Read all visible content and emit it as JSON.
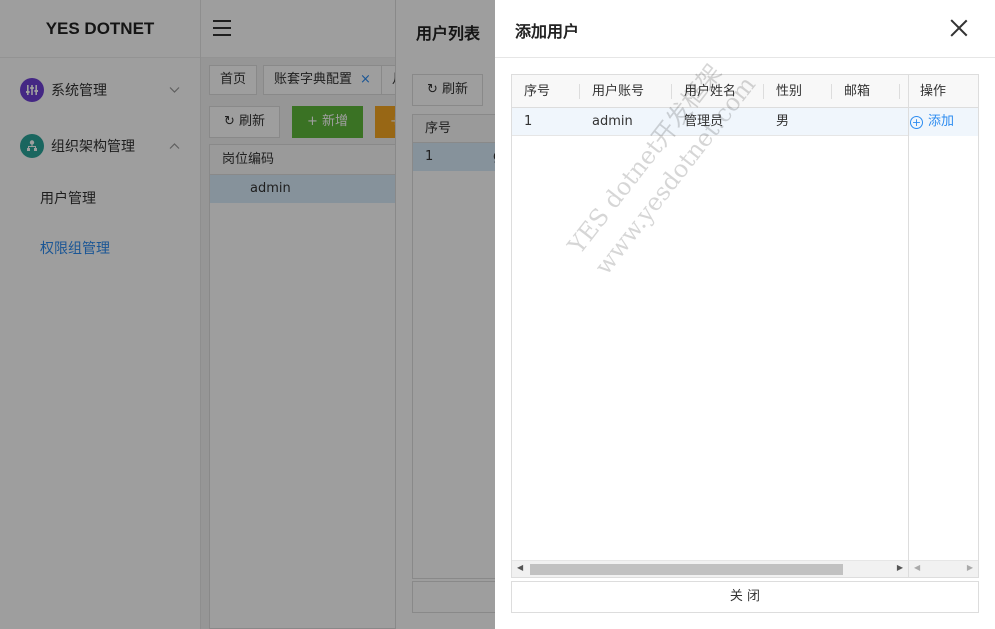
{
  "sidebar": {
    "logo": "YES DOTNET",
    "groups": [
      {
        "label": "系统管理",
        "icon": "sliders-icon",
        "color": "#6f3fd6",
        "chevron": "v"
      },
      {
        "label": "组织架构管理",
        "icon": "org-chart-icon",
        "color": "#2aa59a",
        "chevron": "^"
      }
    ],
    "items": [
      {
        "label": "用户管理"
      },
      {
        "label": "权限组管理"
      }
    ]
  },
  "tabs": [
    {
      "label": "首页"
    },
    {
      "label": "账套字典配置",
      "closable": "×"
    },
    {
      "label": "月"
    }
  ],
  "toolbar": {
    "refresh": "刷新",
    "add": "新增",
    "more": "+"
  },
  "panel": {
    "header": "岗位编码",
    "row": "admin"
  },
  "drawer2": {
    "title": "用户列表",
    "refresh": "刷新",
    "head": "序号",
    "row_index": "1",
    "row_tail": "g"
  },
  "drawer": {
    "title": "添加用户",
    "columns": [
      "序号",
      "用户账号",
      "用户姓名",
      "性别",
      "邮箱",
      "操作"
    ],
    "rows": [
      {
        "index": "1",
        "account": "admin",
        "name": "管理员",
        "gender": "男",
        "email": "",
        "action": "添加"
      }
    ],
    "close_label": "关 闭"
  },
  "watermark": {
    "line1": "YES dotnet开发框架",
    "line2": "www.yesdotnet.com"
  },
  "colors": {
    "accent": "#2d8cf0",
    "green": "#5eb83b",
    "orange": "#f5a623",
    "selected_row": "#d8ecfb"
  }
}
